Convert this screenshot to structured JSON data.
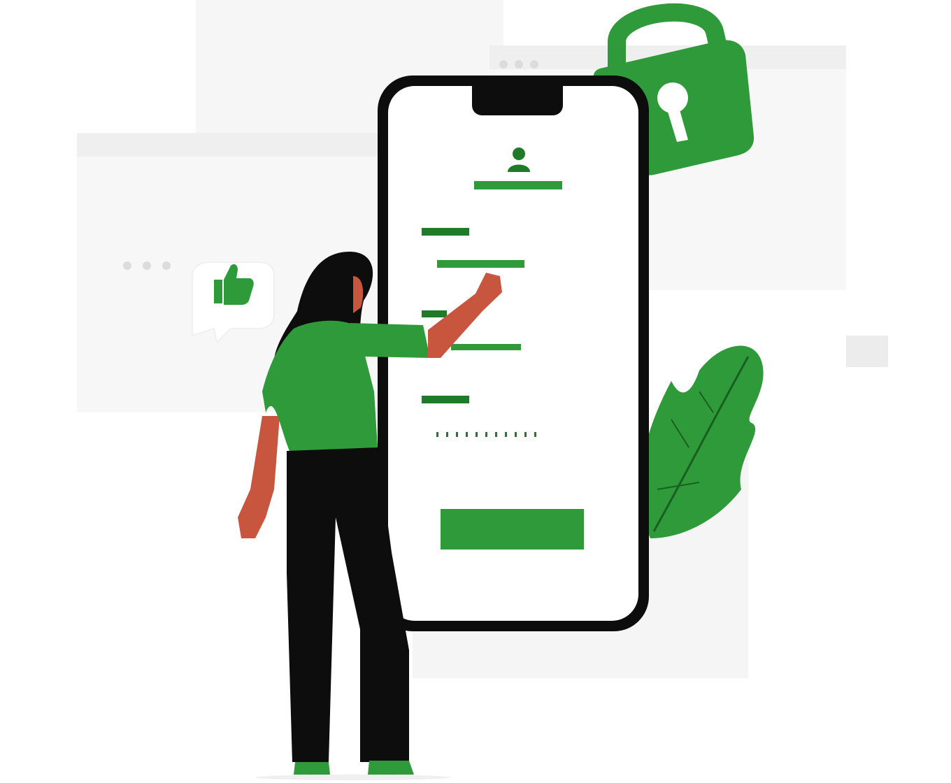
{
  "colors": {
    "accent": "#2f9a3a",
    "accent_dark": "#1f7a2a",
    "ink": "#0d0d0d",
    "skin": "#c8553d",
    "background_window": "#f6f6f6"
  },
  "icons": [
    "lock-icon",
    "user-icon",
    "thumbs-up-icon",
    "leaf-icon"
  ],
  "phone": {
    "login_button_label": ""
  }
}
